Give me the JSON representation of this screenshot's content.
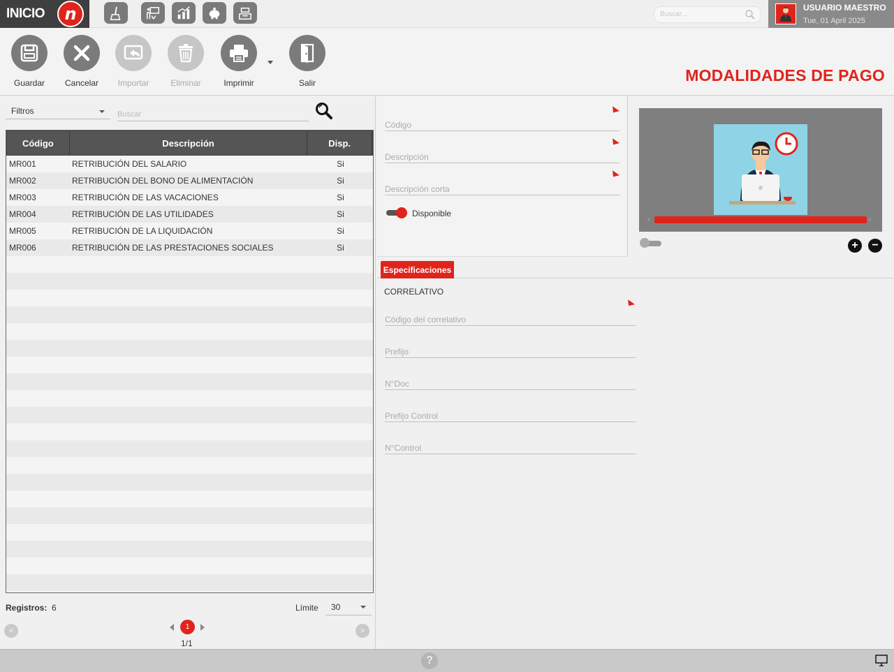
{
  "brand": {
    "logo_text": "INICIO",
    "logo_mark": "n"
  },
  "search_top": {
    "placeholder": "Buscar..."
  },
  "user": {
    "name": "USUARIO MAESTRO",
    "date": "Tue, 01 April 2025"
  },
  "toolbar": {
    "save": "Guardar",
    "cancel": "Cancelar",
    "import": "Importar",
    "delete": "Eliminar",
    "print": "Imprimir",
    "exit": "Salir"
  },
  "page": {
    "title": "MODALIDADES DE PAGO"
  },
  "list": {
    "filter_label": "Filtros",
    "search_placeholder": "Buscar",
    "columns": [
      "Código",
      "Descripción",
      "Disp."
    ],
    "rows": [
      [
        "MR001",
        "RETRIBUCIÓN DEL SALARIO",
        "Si"
      ],
      [
        "MR002",
        "RETRIBUCIÓN DEL BONO DE ALIMENTACIÓN",
        "Si"
      ],
      [
        "MR003",
        "RETRIBUCIÓN DE LAS VACACIONES",
        "Si"
      ],
      [
        "MR004",
        "RETRIBUCIÓN DE LAS UTILIDADES",
        "Si"
      ],
      [
        "MR005",
        "RETRIBUCIÓN DE LA LIQUIDACIÓN",
        "Si"
      ],
      [
        "MR006",
        "RETRIBUCIÓN DE LAS PRESTACIONES SOCIALES",
        "Si"
      ]
    ],
    "records_label": "Registros:",
    "records_count": "6",
    "limit_label": "Límite",
    "limit_value": "30",
    "current_page": "1",
    "page_of": "1/1",
    "prev_symbol": "<",
    "next_symbol": ">"
  },
  "form": {
    "code_label": "Código",
    "description_label": "Descripción",
    "short_description_label": "Descripción corta",
    "available_label": "Disponible",
    "available_on": true
  },
  "image_panel": {
    "plus": "+",
    "minus": "−",
    "chevron_left": "‹",
    "chevron_right": "›"
  },
  "specs": {
    "tab_label": "Especificaciones",
    "section_title": "CORRELATIVO",
    "fields": [
      "Código del correlativo",
      "Prefijo",
      "N°Doc",
      "Prefijo Control",
      "N°Control"
    ]
  },
  "statusbar": {
    "help": "?"
  },
  "colors": {
    "accent": "#e0241c",
    "dark": "#3f3f3f",
    "icon_gray": "#7b7b7b"
  },
  "icons": [
    "broom-icon",
    "presentation-icon",
    "chart-bars-icon",
    "piggy-bank-icon",
    "cash-register-icon",
    "save-icon",
    "close-icon",
    "import-icon",
    "trash-icon",
    "printer-icon",
    "door-exit-icon",
    "search-icon",
    "help-icon",
    "monitor-icon"
  ]
}
